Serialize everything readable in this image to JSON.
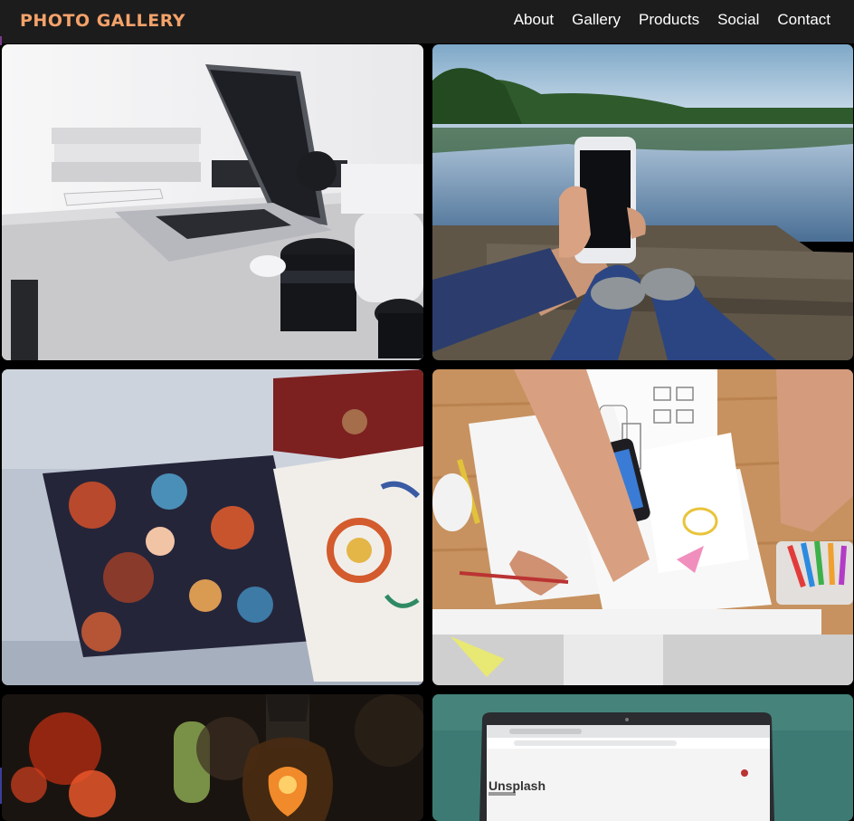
{
  "navbar": {
    "brand": "PHOTO GALLERY",
    "links": [
      "About",
      "Gallery",
      "Products",
      "Social",
      "Contact"
    ]
  },
  "gallery": {
    "photos": [
      {
        "subject": "laptop-desk"
      },
      {
        "subject": "phone-lake"
      },
      {
        "subject": "pillows"
      },
      {
        "subject": "design-sketch"
      },
      {
        "subject": "light-bulb"
      },
      {
        "subject": "laptop-unsplash",
        "screen_text": "Unsplash"
      }
    ]
  },
  "colors": {
    "brand": "#f4a26a",
    "navbar": "#1c1c1c",
    "background": "#000000"
  }
}
